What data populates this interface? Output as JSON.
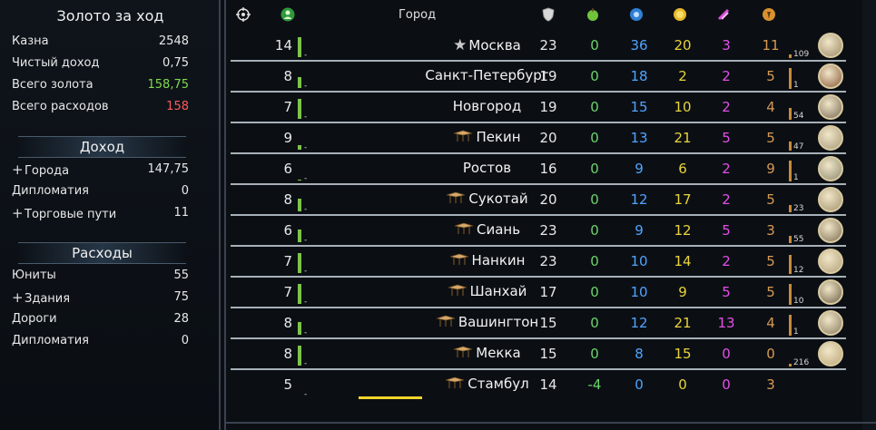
{
  "left": {
    "title": "Золото за ход",
    "summary": [
      {
        "label": "Казна",
        "value": "2548",
        "color": "#e8e8e8"
      },
      {
        "label": "Чистый доход",
        "value": "0,75",
        "color": "#e8e8e8"
      },
      {
        "label": "Всего золота",
        "value": "158,75",
        "color": "#7fdc4a"
      },
      {
        "label": "Всего расходов",
        "value": "158",
        "color": "#ff5a5a"
      }
    ],
    "income_title": "Доход",
    "income": [
      {
        "label": "Города",
        "value": "147,75",
        "expandable": true
      },
      {
        "label": "Дипломатия",
        "value": "0",
        "expandable": false
      },
      {
        "label": "Торговые пути",
        "value": "11",
        "expandable": true
      }
    ],
    "expenses_title": "Расходы",
    "expenses": [
      {
        "label": "Юниты",
        "value": "55",
        "expandable": false
      },
      {
        "label": "Здания",
        "value": "75",
        "expandable": true
      },
      {
        "label": "Дороги",
        "value": "28",
        "expandable": false
      },
      {
        "label": "Дипломатия",
        "value": "0",
        "expandable": false
      }
    ]
  },
  "header": {
    "city_label": "Город",
    "icons": [
      "target-icon",
      "population-icon",
      "defense-icon",
      "food-icon",
      "science-icon",
      "gold-icon",
      "culture-icon",
      "production-icon"
    ],
    "colors": {
      "food": "#6bd46b",
      "science": "#4fa3ff",
      "gold": "#e9d43a",
      "culture": "#e44fe8",
      "production": "#d79a52"
    }
  },
  "cities": [
    {
      "pop": "14",
      "name": "Москва",
      "icon": "capital-star-icon",
      "def": "23",
      "food": "0",
      "sci": "36",
      "gold": "20",
      "cult": "3",
      "prod": "11",
      "prod_num": "109",
      "growth": 0.9,
      "prod_progress": 0.15
    },
    {
      "pop": "8",
      "name": "Санкт-Петербург",
      "icon": "",
      "def": "19",
      "food": "0",
      "sci": "18",
      "gold": "2",
      "cult": "2",
      "prod": "5",
      "prod_num": "1",
      "growth": 0.5,
      "prod_progress": 0.9
    },
    {
      "pop": "7",
      "name": "Новгород",
      "icon": "",
      "def": "19",
      "food": "0",
      "sci": "15",
      "gold": "10",
      "cult": "2",
      "prod": "4",
      "prod_num": "54",
      "growth": 0.9,
      "prod_progress": 0.5
    },
    {
      "pop": "9",
      "name": "Пекин",
      "icon": "puppet-icon",
      "def": "20",
      "food": "0",
      "sci": "13",
      "gold": "21",
      "cult": "5",
      "prod": "5",
      "prod_num": "47",
      "growth": 0.2,
      "prod_progress": 0.4
    },
    {
      "pop": "6",
      "name": "Ростов",
      "icon": "",
      "def": "16",
      "food": "0",
      "sci": "9",
      "gold": "6",
      "cult": "2",
      "prod": "9",
      "prod_num": "1",
      "growth": 0.05,
      "prod_progress": 0.9
    },
    {
      "pop": "8",
      "name": "Сукотай",
      "icon": "puppet-icon",
      "def": "20",
      "food": "0",
      "sci": "12",
      "gold": "17",
      "cult": "2",
      "prod": "5",
      "prod_num": "23",
      "growth": 0.6,
      "prod_progress": 0.3
    },
    {
      "pop": "6",
      "name": "Сиань",
      "icon": "puppet-icon",
      "def": "23",
      "food": "0",
      "sci": "9",
      "gold": "12",
      "cult": "5",
      "prod": "3",
      "prod_num": "55",
      "growth": 0.6,
      "prod_progress": 0.3
    },
    {
      "pop": "7",
      "name": "Нанкин",
      "icon": "puppet-icon",
      "def": "23",
      "food": "0",
      "sci": "10",
      "gold": "14",
      "cult": "2",
      "prod": "5",
      "prod_num": "12",
      "growth": 0.9,
      "prod_progress": 0.8
    },
    {
      "pop": "7",
      "name": "Шанхай",
      "icon": "puppet-icon",
      "def": "17",
      "food": "0",
      "sci": "10",
      "gold": "9",
      "cult": "5",
      "prod": "5",
      "prod_num": "10",
      "growth": 0.9,
      "prod_progress": 0.9
    },
    {
      "pop": "8",
      "name": "Вашингтон",
      "icon": "puppet-icon",
      "def": "15",
      "food": "0",
      "sci": "12",
      "gold": "21",
      "cult": "13",
      "prod": "4",
      "prod_num": "1",
      "growth": 0.6,
      "prod_progress": 0.9
    },
    {
      "pop": "8",
      "name": "Мекка",
      "icon": "puppet-icon",
      "def": "15",
      "food": "0",
      "sci": "8",
      "gold": "15",
      "cult": "0",
      "prod": "0",
      "prod_num": "216",
      "growth": 0.9,
      "prod_progress": 0.1
    },
    {
      "pop": "5",
      "name": "Стамбул",
      "icon": "puppet-icon",
      "def": "14",
      "food": "-4",
      "sci": "0",
      "gold": "0",
      "cult": "0",
      "prod": "3",
      "prod_num": "",
      "growth": 0.0,
      "prod_progress": 0.0
    }
  ]
}
